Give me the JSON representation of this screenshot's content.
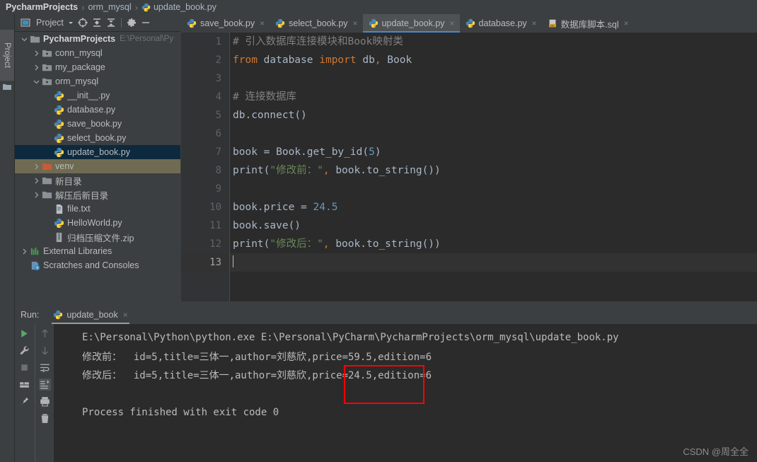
{
  "breadcrumb": {
    "items": [
      {
        "label": "PycharmProjects",
        "icon": "",
        "strong": true
      },
      {
        "label": "orm_mysql",
        "icon": "",
        "strong": false
      },
      {
        "label": "update_book.py",
        "icon": "python-file-icon",
        "strong": false
      }
    ],
    "separator": "›"
  },
  "toolstrip": {
    "project_tab_label": "Project",
    "project_tab_icon": "folder-icon"
  },
  "project_panel": {
    "title": "Project",
    "toolbar_icons": [
      "project-view-icon",
      "chevron-down-icon",
      "locate-target-icon",
      "expand-all-icon",
      "collapse-all-icon",
      "gear-icon",
      "minimize-icon"
    ],
    "tree": [
      {
        "label": "PycharmProjects",
        "path": "E:\\Personal\\Pу",
        "indent": 0,
        "arrow": "down",
        "icon": "folder-icon",
        "state": "normal",
        "bold": true
      },
      {
        "label": "conn_mysql",
        "path": "",
        "indent": 1,
        "arrow": "right",
        "icon": "module-folder-icon",
        "state": "normal",
        "bold": false
      },
      {
        "label": "my_package",
        "path": "",
        "indent": 1,
        "arrow": "right",
        "icon": "module-folder-icon",
        "state": "normal",
        "bold": false
      },
      {
        "label": "orm_mysql",
        "path": "",
        "indent": 1,
        "arrow": "down",
        "icon": "module-folder-icon",
        "state": "normal",
        "bold": false
      },
      {
        "label": "__init__.py",
        "path": "",
        "indent": 2,
        "arrow": "none",
        "icon": "python-file-icon",
        "state": "normal",
        "bold": false
      },
      {
        "label": "database.py",
        "path": "",
        "indent": 2,
        "arrow": "none",
        "icon": "python-file-icon",
        "state": "normal",
        "bold": false
      },
      {
        "label": "save_book.py",
        "path": "",
        "indent": 2,
        "arrow": "none",
        "icon": "python-file-icon",
        "state": "normal",
        "bold": false
      },
      {
        "label": "select_book.py",
        "path": "",
        "indent": 2,
        "arrow": "none",
        "icon": "python-file-icon",
        "state": "normal",
        "bold": false
      },
      {
        "label": "update_book.py",
        "path": "",
        "indent": 2,
        "arrow": "none",
        "icon": "python-file-icon",
        "state": "selected",
        "bold": false
      },
      {
        "label": "venv",
        "path": "",
        "indent": 1,
        "arrow": "right",
        "icon": "excluded-folder-icon",
        "state": "venv",
        "bold": false
      },
      {
        "label": "新目录",
        "path": "",
        "indent": 1,
        "arrow": "right",
        "icon": "folder-icon",
        "state": "normal",
        "bold": false
      },
      {
        "label": "解压后新目录",
        "path": "",
        "indent": 1,
        "arrow": "right",
        "icon": "folder-icon",
        "state": "normal",
        "bold": false
      },
      {
        "label": "file.txt",
        "path": "",
        "indent": 2,
        "arrow": "none",
        "icon": "text-file-icon",
        "state": "normal",
        "bold": false
      },
      {
        "label": "HelloWorld.py",
        "path": "",
        "indent": 2,
        "arrow": "none",
        "icon": "python-file-icon",
        "state": "normal",
        "bold": false
      },
      {
        "label": "归档压缩文件.zip",
        "path": "",
        "indent": 2,
        "arrow": "none",
        "icon": "zip-file-icon",
        "state": "normal",
        "bold": false
      },
      {
        "label": "External Libraries",
        "path": "",
        "indent": 0,
        "arrow": "right",
        "icon": "libraries-icon",
        "state": "normal",
        "bold": false
      },
      {
        "label": "Scratches and Consoles",
        "path": "",
        "indent": 0,
        "arrow": "none",
        "icon": "scratches-icon",
        "state": "normal",
        "bold": false
      }
    ]
  },
  "editor": {
    "tabs": [
      {
        "label": "save_book.py",
        "icon": "python-file-icon",
        "active": false,
        "close": "×"
      },
      {
        "label": "select_book.py",
        "icon": "python-file-icon",
        "active": false,
        "close": "×"
      },
      {
        "label": "update_book.py",
        "icon": "python-file-icon",
        "active": true,
        "close": "×"
      },
      {
        "label": "database.py",
        "icon": "python-file-icon",
        "active": false,
        "close": "×"
      },
      {
        "label": "数据库脚本.sql",
        "icon": "sql-file-icon",
        "active": false,
        "close": "×"
      }
    ],
    "line_numbers": [
      "1",
      "2",
      "3",
      "4",
      "5",
      "6",
      "7",
      "8",
      "9",
      "10",
      "11",
      "12",
      "13"
    ],
    "current_line": 13,
    "lines": [
      {
        "n": 1,
        "text": "# 引入数据库连接模块和Book映射类"
      },
      {
        "n": 2,
        "text": "from database import db, Book"
      },
      {
        "n": 3,
        "text": ""
      },
      {
        "n": 4,
        "text": "# 连接数据库"
      },
      {
        "n": 5,
        "text": "db.connect()"
      },
      {
        "n": 6,
        "text": ""
      },
      {
        "n": 7,
        "text": "book = Book.get_by_id(5)"
      },
      {
        "n": 8,
        "text": "print(\"修改前：\", book.to_string())"
      },
      {
        "n": 9,
        "text": ""
      },
      {
        "n": 10,
        "text": "book.price = 24.5"
      },
      {
        "n": 11,
        "text": "book.save()"
      },
      {
        "n": 12,
        "text": "print(\"修改后：\", book.to_string())"
      },
      {
        "n": 13,
        "text": ""
      }
    ],
    "colors": {
      "background": "#2B2B2B",
      "gutter": "#313335",
      "keyword": "#CC7832",
      "string": "#6A8759",
      "number": "#6897BB",
      "comment": "#808080",
      "identifier": "#A9B7C6",
      "current_line": "#323232",
      "tab_underline": "#4A88C7"
    }
  },
  "run_panel": {
    "label": "Run:",
    "tab_label": "update_book",
    "tab_icon": "python-file-icon",
    "tab_close": "×",
    "left_tools": [
      "run-icon",
      "settings-wrench-icon",
      "stop-icon",
      "layout-icon",
      "pin-icon"
    ],
    "right_tools": [
      "arrow-up-icon",
      "arrow-down-icon",
      "soft-wrap-icon",
      "scroll-to-end-icon",
      "print-icon",
      "trash-icon"
    ],
    "console_lines": [
      "E:\\Personal\\Python\\python.exe E:\\Personal\\PyCharm\\PycharmProjects\\orm_mysql\\update_book.py",
      "修改前：  id=5,title=三体一,author=刘慈欣,price=59.5,edition=6",
      "修改后：  id=5,title=三体一,author=刘慈欣,price=24.5,edition=6",
      "",
      "Process finished with exit code 0"
    ],
    "annotation": {
      "type": "red-rectangle",
      "color": "#FF0000"
    }
  },
  "watermark": "CSDN @周全全"
}
